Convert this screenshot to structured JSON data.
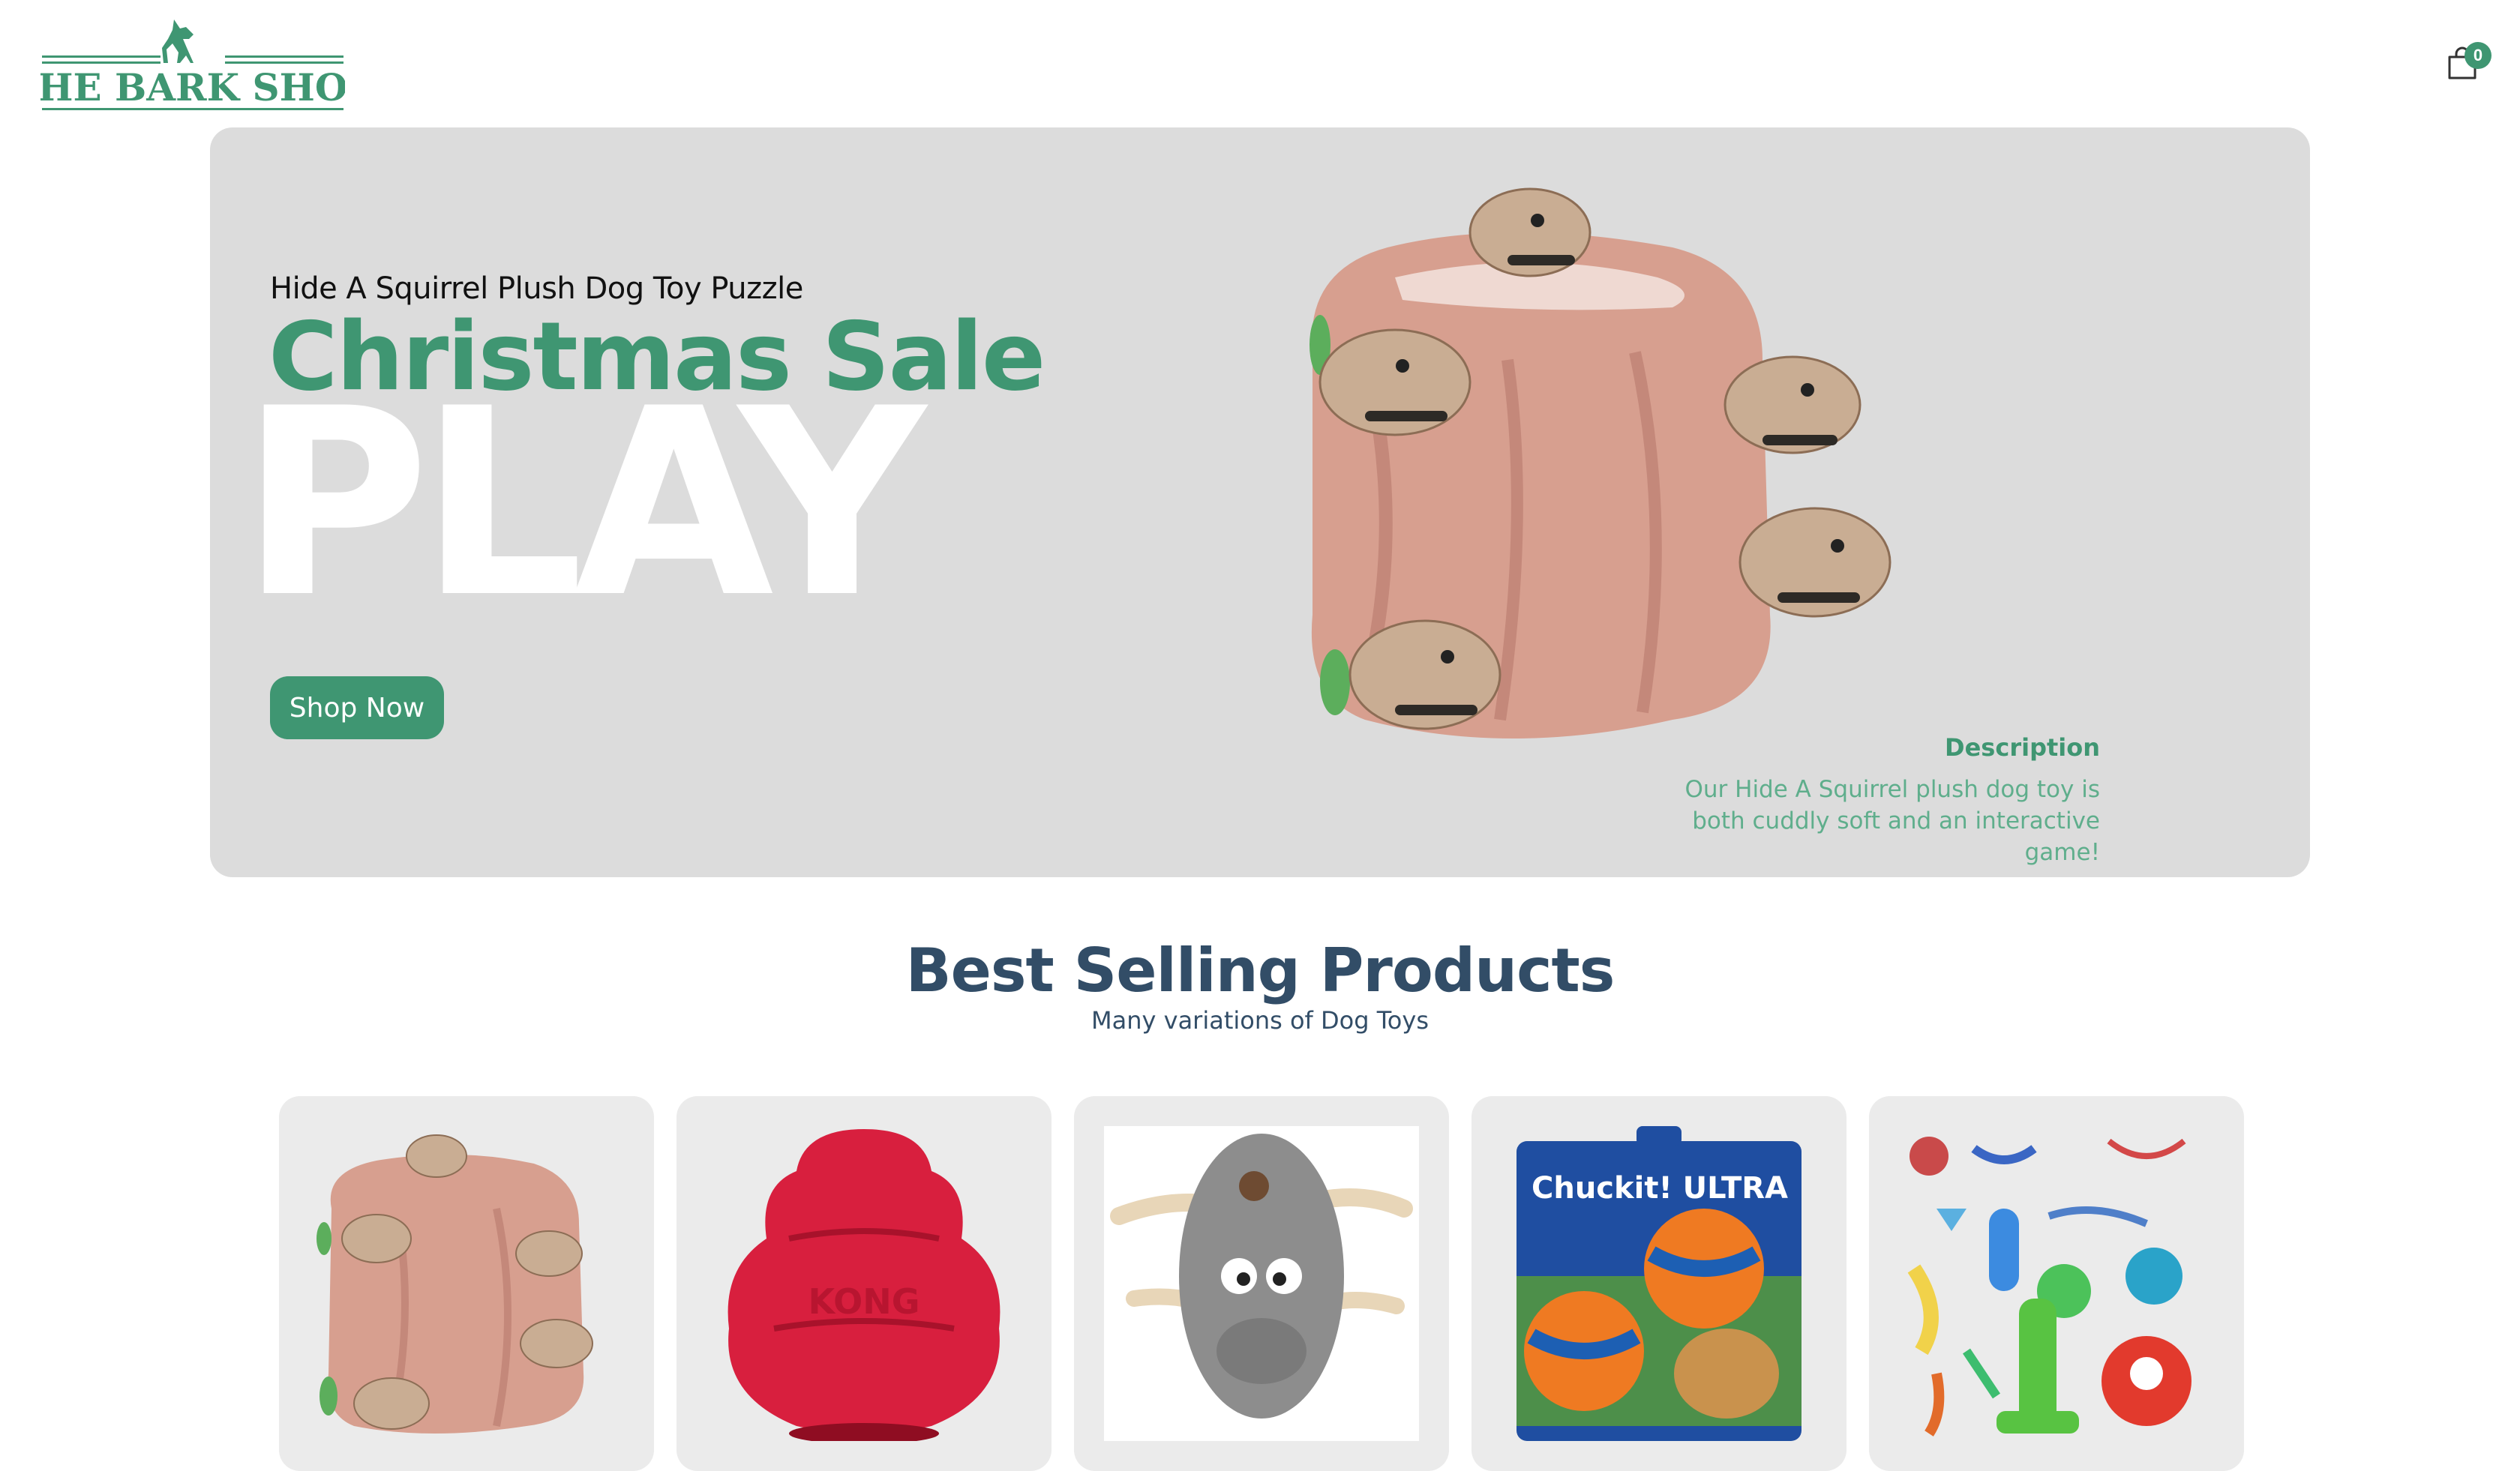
{
  "header": {
    "logo_text": "THE BARK SHOP",
    "logo_icon": "dog-icon",
    "cart_icon": "shopping-bag-icon",
    "cart_count": "0"
  },
  "hero": {
    "small_text": "Hide A Squirrel Plush Dog Toy Puzzle",
    "mid_text": "Christmas Sale",
    "large_text": "PLAY",
    "button_label": "Shop Now",
    "image": "hide-a-squirrel-plush-toy",
    "description_title": "Description",
    "description_text": "Our Hide A Squirrel plush dog toy is both cuddly soft and an interactive game!"
  },
  "best_selling": {
    "title": "Best Selling Products",
    "subtitle": "Many variations of Dog Toys",
    "products": [
      {
        "image": "hide-a-squirrel-toy"
      },
      {
        "image": "kong-toy",
        "print": "KONG"
      },
      {
        "image": "plush-donkey-toy"
      },
      {
        "image": "chuckit-ultra-ball",
        "print": "Chuckit! ULTRA"
      },
      {
        "image": "rope-toy-set"
      }
    ]
  },
  "colors": {
    "accent": "#3f9672",
    "heading": "#324d67",
    "hero_bg": "#dcdcdc",
    "card_bg": "#ebebeb"
  }
}
